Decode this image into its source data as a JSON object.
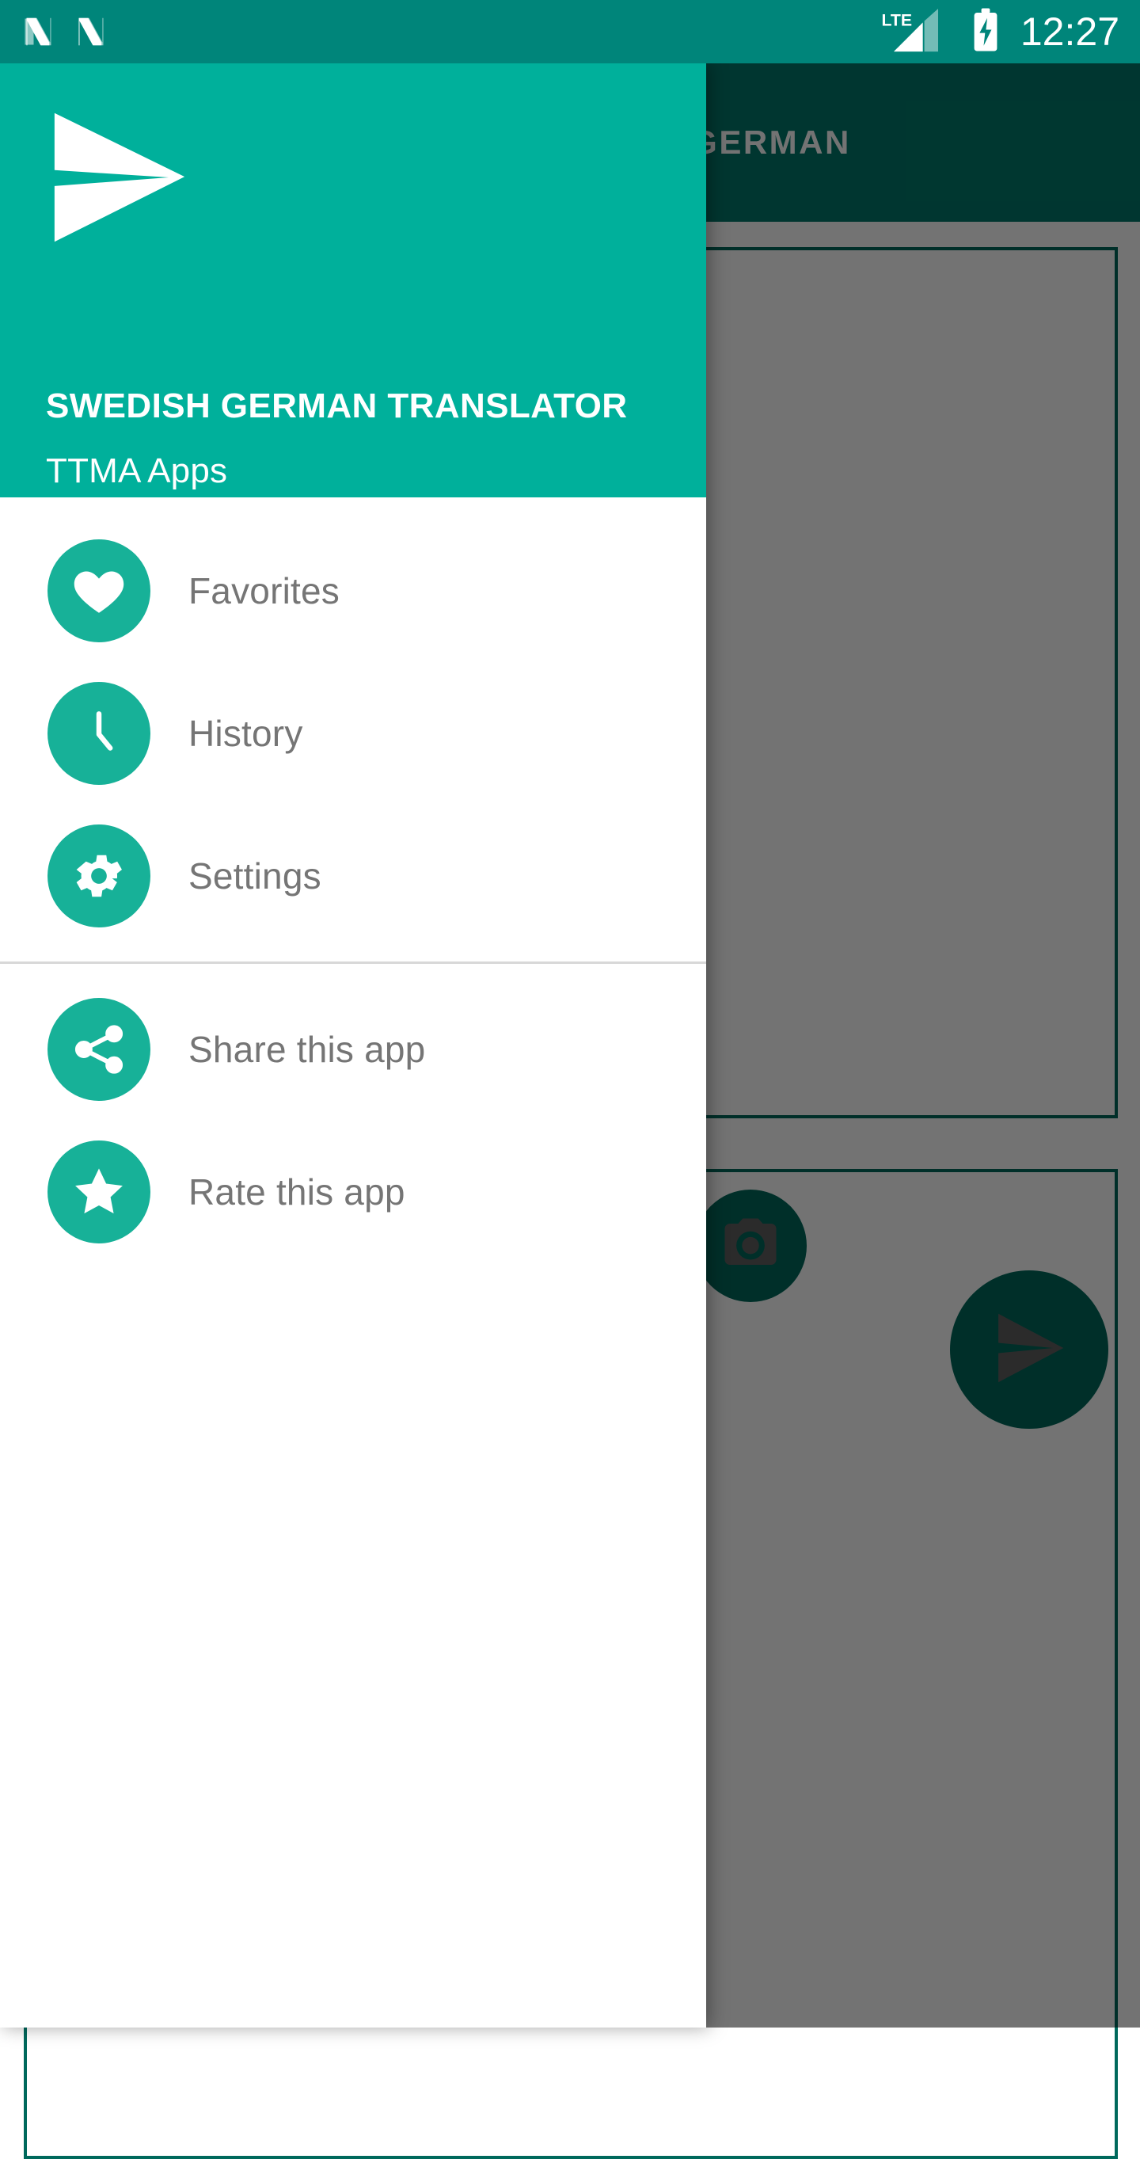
{
  "status_bar": {
    "notification_icons": [
      "android-n-icon",
      "android-n-icon"
    ],
    "network_label": "LTE",
    "signal_icon": "signal-bars-icon",
    "battery_icon": "battery-charging-icon",
    "time": "12:27"
  },
  "app": {
    "toolbar": {
      "active_tab": "GERMAN"
    },
    "body": {
      "source_card_name": "source-text-card",
      "target_card_name": "target-text-card",
      "camera_fab_icon": "camera-icon",
      "send_fab_icon": "send-icon"
    }
  },
  "drawer": {
    "logo_icon": "paper-plane-send-icon",
    "title": "SWEDISH GERMAN TRANSLATOR",
    "subtitle": "TTMA Apps",
    "primary_items": [
      {
        "label": "Favorites",
        "icon": "heart-icon"
      },
      {
        "label": "History",
        "icon": "clock-icon"
      },
      {
        "label": "Settings",
        "icon": "gear-icon"
      }
    ],
    "secondary_items": [
      {
        "label": "Share this app",
        "icon": "share-icon"
      },
      {
        "label": "Rate this app",
        "icon": "star-icon"
      }
    ]
  },
  "colors": {
    "status_bar": "#00857A",
    "drawer_header": "#00B09B",
    "toolbar": "#00796B",
    "icon_badge": "#17B198",
    "accent_dark": "#00695C",
    "menu_text": "#757575",
    "divider": "#d8d8d8",
    "scrim": "rgba(0,0,0,0.55)"
  }
}
